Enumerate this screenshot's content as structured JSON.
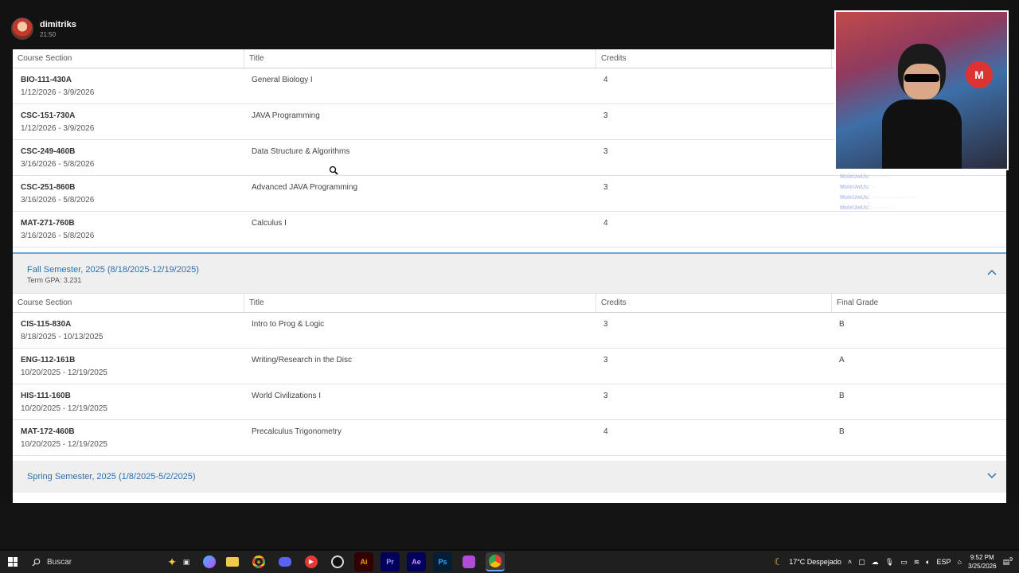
{
  "overlay_user": {
    "name": "dimitriks",
    "time": "21:50"
  },
  "table_top": {
    "headers": [
      "Course Section",
      "Title",
      "Credits"
    ],
    "rows": [
      {
        "code": "BIO-111-430A",
        "dates": "1/12/2026 - 3/9/2026",
        "title": "General Biology I",
        "credits": "4"
      },
      {
        "code": "CSC-151-730A",
        "dates": "1/12/2026 - 3/9/2026",
        "title": "JAVA Programming",
        "credits": "3"
      },
      {
        "code": "CSC-249-460B",
        "dates": "3/16/2026 - 5/8/2026",
        "title": "Data Structure & Algorithms",
        "credits": "3"
      },
      {
        "code": "CSC-251-860B",
        "dates": "3/16/2026 - 5/8/2026",
        "title": "Advanced JAVA Programming",
        "credits": "3"
      },
      {
        "code": "MAT-271-760B",
        "dates": "3/16/2026 - 5/8/2026",
        "title": "Calculus I",
        "credits": "4"
      }
    ]
  },
  "fall": {
    "title": "Fall Semester, 2025 (8/18/2025-12/19/2025)",
    "gpa": "Term GPA: 3.231",
    "headers": [
      "Course Section",
      "Title",
      "Credits",
      "Final Grade"
    ],
    "rows": [
      {
        "code": "CIS-115-830A",
        "dates": "8/18/2025 - 10/13/2025",
        "title": "Intro to Prog & Logic",
        "credits": "3",
        "grade": "B"
      },
      {
        "code": "ENG-112-161B",
        "dates": "10/20/2025 - 12/19/2025",
        "title": "Writing/Research in the Disc",
        "credits": "3",
        "grade": "A"
      },
      {
        "code": "HIS-111-160B",
        "dates": "10/20/2025 - 12/19/2025",
        "title": "World Civilizations I",
        "credits": "3",
        "grade": "B"
      },
      {
        "code": "MAT-172-460B",
        "dates": "10/20/2025 - 12/19/2025",
        "title": "Precalculus Trigonometry",
        "credits": "4",
        "grade": "B"
      }
    ]
  },
  "spring": {
    "title": "Spring Semester, 2025 (1/8/2025-5/2/2025)"
  },
  "chat": [
    {
      "user": "MoleUwUs:"
    },
    {
      "user": "MoleUwUs:"
    },
    {
      "user": "MoleUwUs:"
    },
    {
      "user": "MoleUwUs:"
    }
  ],
  "taskbar": {
    "search_placeholder": "Buscar",
    "apps": [
      "Ai",
      "Pr",
      "Ae",
      "Ps"
    ],
    "weather": "17°C Despejado",
    "lang": "ESP",
    "time": "9:52 PM",
    "date": "3/25/2026",
    "notifications": "9"
  },
  "colors": {
    "accent": "#2a6fb5",
    "section_bg": "#efefef",
    "taskbar_bg": "#1f1f1f"
  }
}
